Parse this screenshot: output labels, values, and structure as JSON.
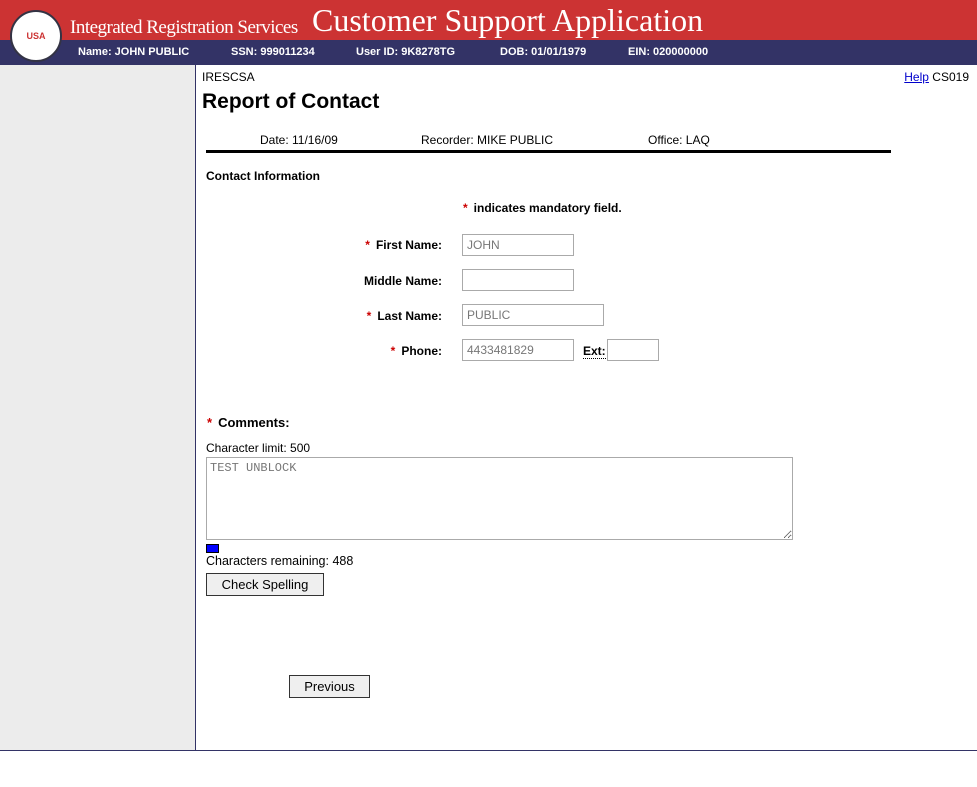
{
  "header": {
    "logo_text": "USA",
    "system": "Integrated Registration Services",
    "app_title": "Customer Support Application"
  },
  "info": {
    "name": "Name: JOHN PUBLIC",
    "ssn": "SSN: 999011234",
    "user_id": "User ID: 9K8278TG",
    "dob": "DOB: 01/01/1979",
    "ein": "EIN: 020000000"
  },
  "page": {
    "app_code": "IRESCSA",
    "help": "Help",
    "screen_id": "CS019",
    "title": "Report of Contact",
    "date": "Date: 11/16/09",
    "recorder": "Recorder: MIKE PUBLIC",
    "office": "Office: LAQ"
  },
  "form": {
    "section": "Contact Information",
    "star": "*",
    "mandatory_note": "indicates mandatory field.",
    "first_name_label": "First Name:",
    "first_name": "JOHN",
    "middle_name_label": "Middle Name:",
    "middle_name": "",
    "last_name_label": "Last Name:",
    "last_name": "PUBLIC",
    "phone_label": "Phone:",
    "phone": "4433481829",
    "ext_label": "Ext:",
    "ext": "",
    "comments_label": "Comments:",
    "char_limit": "Character limit: 500",
    "comments": "TEST UNBLOCK",
    "remaining": "Characters remaining:  488",
    "usage_fraction": 0.024,
    "check_spelling": "Check Spelling",
    "previous": "Previous"
  }
}
